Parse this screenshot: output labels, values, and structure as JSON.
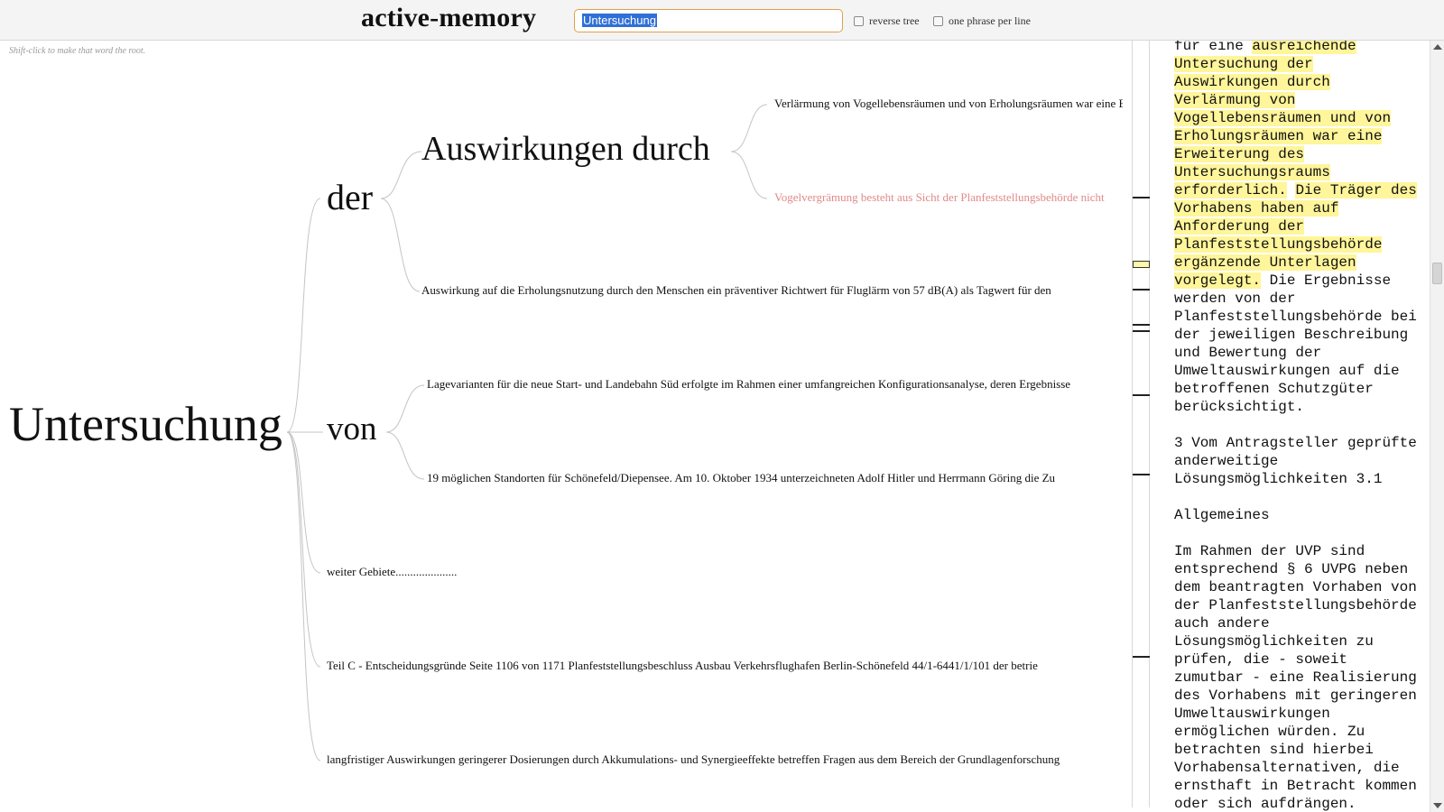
{
  "app": {
    "title": "active-memory"
  },
  "search": {
    "value": "Untersuchung"
  },
  "options": {
    "reverse_tree": "reverse tree",
    "one_phrase": "one phrase per line"
  },
  "hint": "Shift-click to make that word the root.",
  "tree": {
    "root": "Untersuchung",
    "der": "der",
    "auswirkungen": "Auswirkungen durch",
    "leaf_verlaermung": "Verlärmung von Vogellebensräumen und von Erholungsräumen war eine Erweiterung",
    "leaf_vogelvergraemung": "Vogelvergrämung besteht aus Sicht der Planfeststellungsbehörde nicht",
    "leaf_auswirkung": "Auswirkung auf die Erholungsnutzung durch den Menschen ein präventiver Richtwert für Fluglärm von 57 dB(A) als Tagwert für den",
    "von": "von",
    "leaf_lagevarianten": "Lagevarianten für die neue Start- und Landebahn Süd erfolgte im Rahmen einer umfangreichen Konfigurationsanalyse, deren Ergebnisse",
    "leaf_19": "19 möglichen Standorten für Schönefeld/Diepensee. Am 10. Oktober 1934 unterzeichneten Adolf Hitler und Herrmann Göring die Zu",
    "leaf_weiter": "weiter Gebiete.....................",
    "leaf_teil": "Teil C - Entscheidungsgründe Seite 1106 von 1171 Planfeststellungsbeschluss Ausbau Verkehrsflughafen Berlin-Schönefeld 44/1-6441/1/101 der betrie",
    "leaf_langfristig": "langfristiger Auswirkungen geringerer Dosierungen durch Akkumulations- und Synergieeffekte betreffen Fragen aus dem Bereich der Grundlagenforschung"
  },
  "text_pane": {
    "segments": [
      {
        "t": "für eine ",
        "h": false
      },
      {
        "t": "ausreichende\nUntersuchung der\nAuswirkungen durch\nVerlärmung von\nVogellebensräumen und von\nErholungsräumen war eine\nErweiterung des\nUntersuchungsraums\nerforderlich.",
        "h": true
      },
      {
        "t": " ",
        "h": false
      },
      {
        "t": "Die Träger des\nVorhabens haben auf\nAnforderung der\nPlanfeststellungsbehörde\nergänzende Unterlagen\nvorgelegt.",
        "h": true
      },
      {
        "t": " Die Ergebnisse\nwerden von der\nPlanfeststellungsbehörde bei\nder jeweiligen Beschreibung\nund Bewertung der\nUmweltauswirkungen auf die\nbetroffenen Schutzgüter\nberücksichtigt.\n\n3 Vom Antragsteller geprüfte\nanderweitige\nLösungsmöglichkeiten 3.1\n\nAllgemeines\n\nIm Rahmen der UVP sind\nentsprechend § 6 UVPG neben\ndem beantragten Vorhaben von\nder Planfeststellungsbehörde\nauch andere\nLösungsmöglichkeiten zu\nprüfen, die - soweit\nzumutbar - eine Realisierung\ndes Vorhabens mit geringeren\nUmweltauswirkungen\nermöglichen würden. Zu\nbetrachten sind hierbei\nVorhabensalternativen, die\nernsthaft in Betracht kommen\noder sich aufdrängen.",
        "h": false
      }
    ]
  },
  "colors": {
    "accent_input_border": "#e0a04a",
    "highlight": "#fff59a",
    "faded_leaf": "#e08a8a",
    "selection": "#2f6fd6"
  }
}
